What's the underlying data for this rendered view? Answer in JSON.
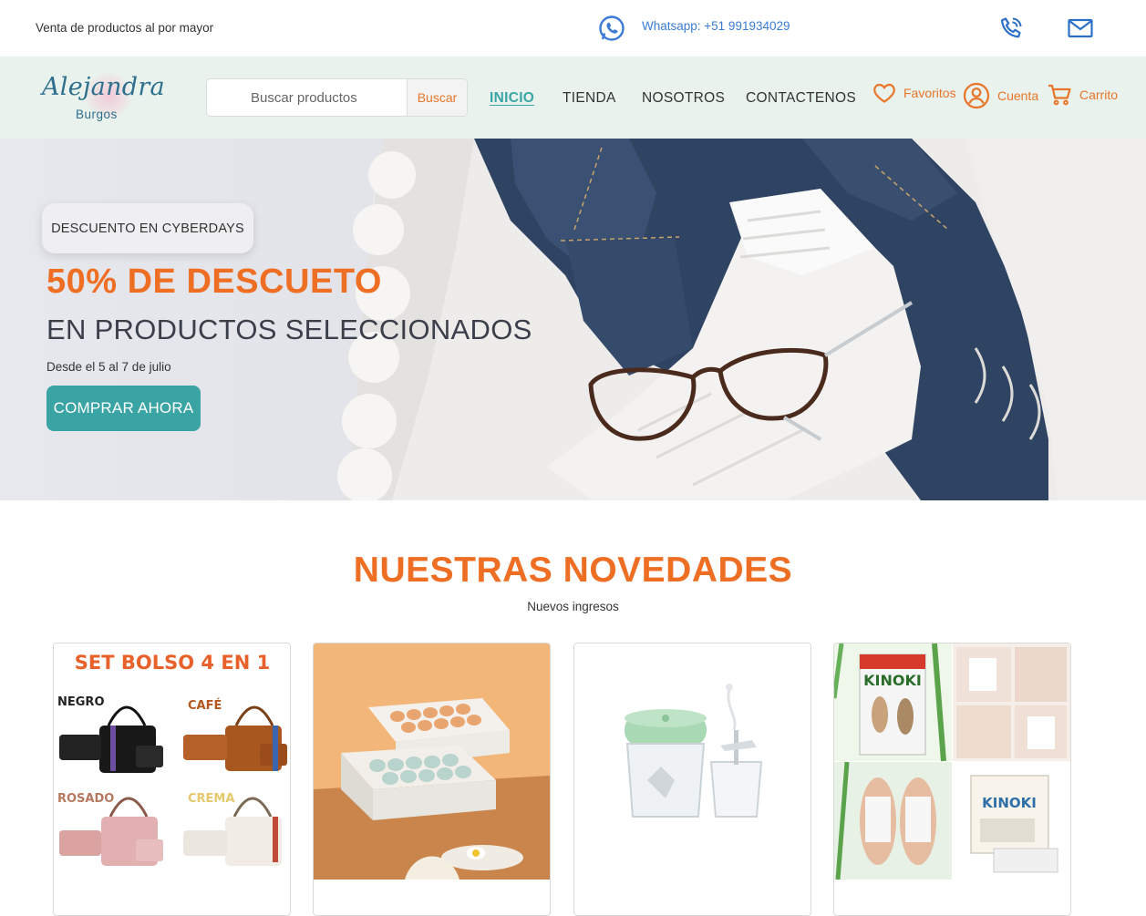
{
  "topbar": {
    "tagline": "Venta de productos al por mayor",
    "whatsapp": "Whatsapp: +51 991934029",
    "icons": [
      "whatsapp-icon",
      "phone-icon",
      "mail-icon"
    ]
  },
  "brand": {
    "name": "Alejandra",
    "sub": "Burgos"
  },
  "search": {
    "placeholder": "Buscar productos",
    "button": "Buscar"
  },
  "nav": {
    "items": [
      {
        "label": "INICIO",
        "active": true
      },
      {
        "label": "TIENDA",
        "active": false
      },
      {
        "label": "NOSOTROS",
        "active": false
      },
      {
        "label": "CONTACTENOS",
        "active": false
      }
    ]
  },
  "user_links": {
    "favorites": "Favoritos",
    "account": "Cuenta",
    "cart": "Carrito"
  },
  "hero": {
    "badge": "DESCUENTO EN CYBERDAYS",
    "headline": "50% DE DESCUETO",
    "subheadline": "EN PRODUCTOS SELECCIONADOS",
    "dates": "Desde el 5 al 7 de julio",
    "cta": "COMPRAR AHORA"
  },
  "novedades": {
    "title": "NUESTRAS NOVEDADES",
    "subtitle": "Nuevos ingresos",
    "products": [
      {
        "image": "bag-set",
        "banner": "SET BOLSO 4 EN 1",
        "variants": [
          "NEGRO",
          "CAFÉ",
          "ROSADO",
          "CREMA"
        ]
      },
      {
        "image": "egg-organizer"
      },
      {
        "image": "mini-chopper"
      },
      {
        "image": "kinoki-pads",
        "brand_text": "KINOKI"
      }
    ]
  },
  "colors": {
    "accent_orange": "#ee6f23",
    "teal": "#3aa3a4",
    "nav_bg": "#e9f2ec",
    "link_blue": "#3b7bd4"
  }
}
